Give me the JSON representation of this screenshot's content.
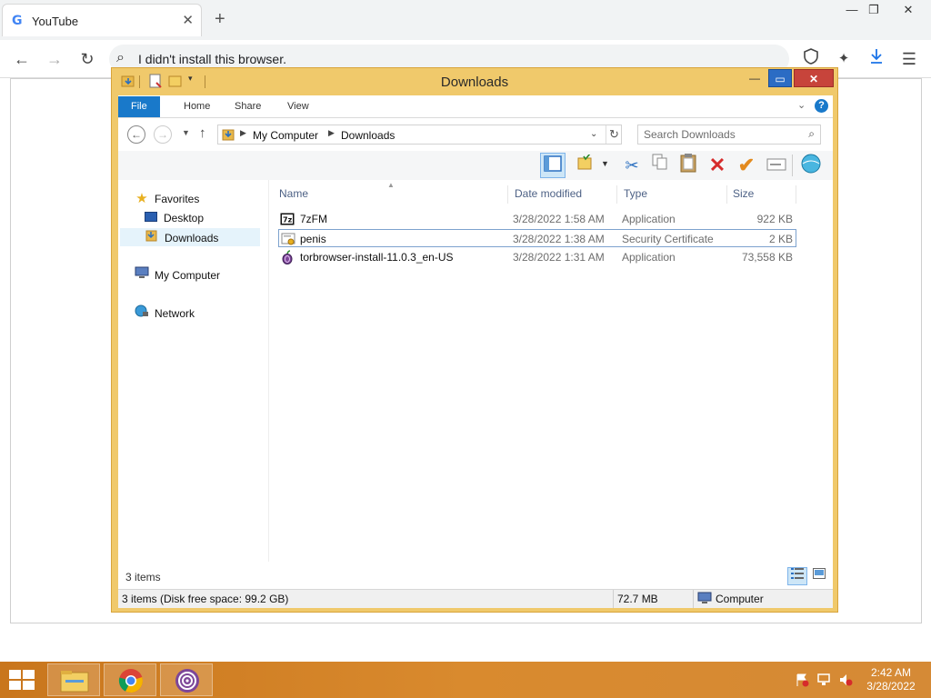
{
  "browser": {
    "tab_title": "YouTube",
    "tab_favicon": "G",
    "address_text": "I didn't install this browser.",
    "colors": {
      "accent": "#1a73e8"
    }
  },
  "explorer": {
    "window_title": "Downloads",
    "ribbon_tabs": [
      "File",
      "Home",
      "Share",
      "View"
    ],
    "breadcrumb": [
      "My Computer",
      "Downloads"
    ],
    "search_placeholder": "Search Downloads",
    "nav": {
      "favorites": "Favorites",
      "desktop": "Desktop",
      "downloads": "Downloads",
      "my_computer": "My Computer",
      "network": "Network"
    },
    "columns": [
      "Name",
      "Date modified",
      "Type",
      "Size"
    ],
    "files": [
      {
        "name": "7zFM",
        "date": "3/28/2022 1:58 AM",
        "type": "Application",
        "size": "922 KB",
        "icon": "7zip-icon"
      },
      {
        "name": "penis",
        "date": "3/28/2022 1:38 AM",
        "type": "Security Certificate",
        "size": "2 KB",
        "icon": "certificate-icon"
      },
      {
        "name": "torbrowser-install-11.0.3_en-US",
        "date": "3/28/2022 1:31 AM",
        "type": "Application",
        "size": "73,558 KB",
        "icon": "tor-onion-icon"
      }
    ],
    "item_count": "3 items",
    "status": {
      "left": "3 items (Disk free space: 99.2 GB)",
      "size": "72.7 MB",
      "location": "Computer"
    },
    "colors": {
      "frame": "#f0c96b",
      "file_tab": "#1979ca",
      "close": "#c7443b"
    }
  },
  "taskbar": {
    "time": "2:42 AM",
    "date": "3/28/2022",
    "colors": {
      "bar": "#d0802a"
    }
  }
}
